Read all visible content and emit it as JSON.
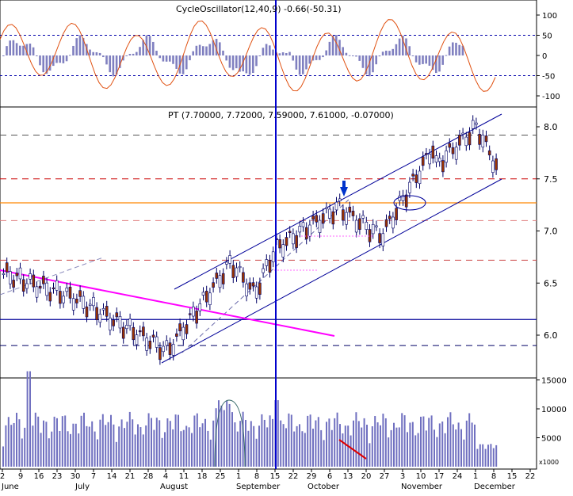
{
  "colors": {
    "background": "#ffffff",
    "frame": "#000000",
    "candle_up": "#ffffff",
    "candle_down": "#993300",
    "candle_outline": "#000066",
    "channel": "#000099",
    "trend_line": "#ff00ff",
    "cycle_bars": "#8080c0",
    "cycle_line": "#e05010",
    "volume_bars": "#7070c0",
    "orange_level": "#ff8800",
    "red_level": "#cc0000",
    "marker_line": "#0000cc",
    "arrow": "#0033cc",
    "ellipse_volume": "#336666",
    "volume_trend": "#dd0000"
  },
  "panels": {
    "cycle": {
      "label": "CycleOscillator(12,40,9)  -0.66(-50.31)",
      "y_ticks": [
        "100",
        "50",
        "0",
        "-50",
        "-100"
      ]
    },
    "price": {
      "label": "PT (7.70000, 7.72000, 7.59000, 7.61000, -0.07000)",
      "y_ticks": [
        "8.0",
        "7.5",
        "7.0",
        "6.5",
        "6.0"
      ]
    },
    "volume": {
      "y_ticks": [
        "15000",
        "10000",
        "5000"
      ],
      "unit": "x1000"
    }
  },
  "x_axis": {
    "day_labels": [
      "2",
      "9",
      "16",
      "23",
      "30",
      "7",
      "14",
      "21",
      "28",
      "4",
      "11",
      "18",
      "25",
      "1",
      "8",
      "15",
      "22",
      "29",
      "6",
      "13",
      "20",
      "27",
      "3",
      "10",
      "17",
      "24",
      "1",
      "8",
      "15",
      "22"
    ],
    "month_labels": [
      "June",
      "July",
      "August",
      "September",
      "October",
      "November",
      "December"
    ]
  },
  "chart_data": {
    "type": "candlestick",
    "title": "",
    "price_range": [
      5.7,
      8.25
    ],
    "horizontal_levels": [
      {
        "value": 7.92,
        "style": "dashed",
        "color": "#555555"
      },
      {
        "value": 7.5,
        "style": "dashed",
        "color": "#cc0000"
      },
      {
        "value": 7.27,
        "style": "solid",
        "color": "#ff8800"
      },
      {
        "value": 7.1,
        "style": "dashed",
        "color": "#e08080"
      },
      {
        "value": 6.72,
        "style": "dashed",
        "color": "#cc4444"
      },
      {
        "value": 6.15,
        "style": "solid",
        "color": "#000099"
      },
      {
        "value": 5.9,
        "style": "dashed",
        "color": "#000066"
      }
    ],
    "last_close": 7.61,
    "last_change": -0.07,
    "cycle_range": [
      -110,
      110
    ],
    "volume_max_k": 17000
  }
}
